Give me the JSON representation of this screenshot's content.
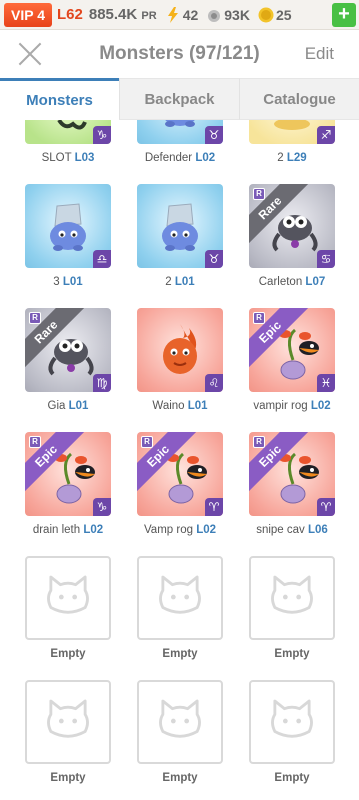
{
  "status": {
    "vip": "VIP 4",
    "level": "L62",
    "pr_value": "885.4K",
    "pr_unit": "PR",
    "energy": "42",
    "food": "93K",
    "coins": "25",
    "add_label": "+"
  },
  "header": {
    "title": "Monsters (97/121)",
    "edit": "Edit"
  },
  "tabs": [
    "Monsters",
    "Backpack",
    "Catalogue"
  ],
  "monsters": [
    {
      "name": "SLOT",
      "level": "L03",
      "zodiac": "♑",
      "bg": "green",
      "rarity": ""
    },
    {
      "name": "Defender",
      "level": "L02",
      "zodiac": "♉",
      "bg": "blue",
      "rarity": ""
    },
    {
      "name": "2",
      "level": "L29",
      "zodiac": "♐",
      "bg": "yellow",
      "rarity": ""
    },
    {
      "name": "3",
      "level": "L01",
      "zodiac": "♎",
      "bg": "blue",
      "rarity": ""
    },
    {
      "name": "2",
      "level": "L01",
      "zodiac": "♉",
      "bg": "blue",
      "rarity": ""
    },
    {
      "name": "Carleton",
      "level": "L07",
      "zodiac": "♋",
      "bg": "gray",
      "rarity": "Rare"
    },
    {
      "name": "Gia",
      "level": "L01",
      "zodiac": "♍",
      "bg": "gray",
      "rarity": "Rare"
    },
    {
      "name": "Waino",
      "level": "L01",
      "zodiac": "♌",
      "bg": "red",
      "rarity": ""
    },
    {
      "name": "vampir rog",
      "level": "L02",
      "zodiac": "♓",
      "bg": "red",
      "rarity": "Epic"
    },
    {
      "name": "drain leth",
      "level": "L02",
      "zodiac": "♑",
      "bg": "red",
      "rarity": "Epic"
    },
    {
      "name": "Vamp rog",
      "level": "L02",
      "zodiac": "♈",
      "bg": "red",
      "rarity": "Epic"
    },
    {
      "name": "snipe cav",
      "level": "L06",
      "zodiac": "♈",
      "bg": "red",
      "rarity": "Epic"
    }
  ],
  "empty_label": "Empty",
  "rarity_badge": "R",
  "colors": {
    "accent": "#3d7fb8",
    "vip": "#e8431a",
    "add": "#48c044",
    "zodiac_badge": "#6c46a8"
  }
}
